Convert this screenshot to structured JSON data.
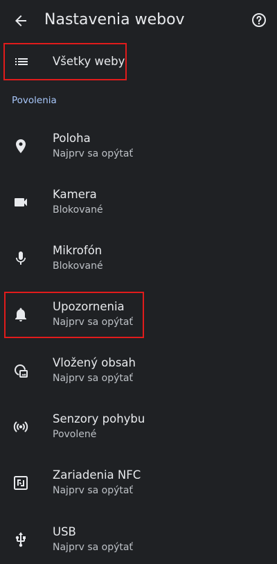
{
  "app_bar": {
    "title": "Nastavenia webov",
    "back_icon": "arrow-back-icon",
    "help_icon": "help-circle-icon"
  },
  "all_sites": {
    "label": "Všetky weby",
    "icon": "list-icon"
  },
  "section": {
    "title": "Povolenia"
  },
  "permissions": [
    {
      "label": "Poloha",
      "status": "Najprv sa opýtať",
      "icon": "location-pin-icon"
    },
    {
      "label": "Kamera",
      "status": "Blokované",
      "icon": "videocam-icon"
    },
    {
      "label": "Mikrofón",
      "status": "Blokované",
      "icon": "microphone-icon"
    },
    {
      "label": "Upozornenia",
      "status": "Najprv sa opýtať",
      "icon": "bell-icon"
    },
    {
      "label": "Vložený obsah",
      "status": "Najprv sa opýtať",
      "icon": "embedded-content-icon"
    },
    {
      "label": "Senzory pohybu",
      "status": "Povolené",
      "icon": "motion-sensor-icon"
    },
    {
      "label": "Zariadenia NFC",
      "status": "Najprv sa opýtať",
      "icon": "nfc-icon"
    },
    {
      "label": "USB",
      "status": "Najprv sa opýtať",
      "icon": "usb-icon"
    }
  ],
  "colors": {
    "background": "#1f2124",
    "text_primary": "#e8eaed",
    "text_secondary": "#bdc1c6",
    "section_accent": "#a8c7fa",
    "highlight_border": "#e11b1b"
  }
}
